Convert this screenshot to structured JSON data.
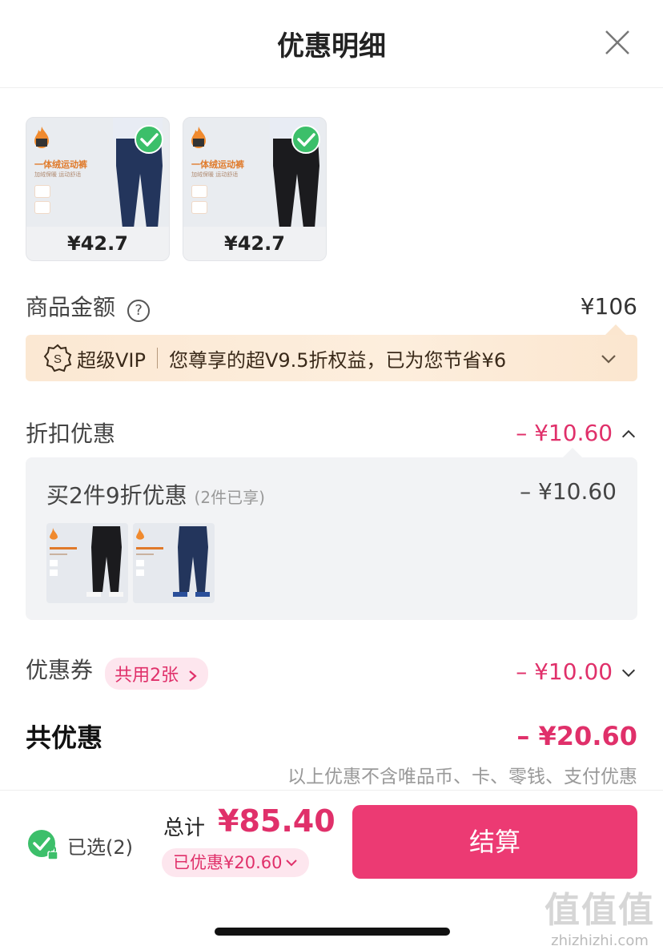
{
  "header": {
    "title": "优惠明细"
  },
  "products": [
    {
      "tag": "一体绒运动裤",
      "sub": "加绒保暖 运动舒适",
      "price": "¥42.7",
      "color": "#23355c"
    },
    {
      "tag": "一体绒运动裤",
      "sub": "加绒保暖 运动舒适",
      "price": "¥42.7",
      "color": "#1b1b1e"
    }
  ],
  "goods_amount": {
    "label": "商品金额",
    "value": "¥106"
  },
  "vip": {
    "label": "超级VIP",
    "text": "您尊享的超V9.5折权益，已为您节省¥6"
  },
  "discount": {
    "label": "折扣优惠",
    "value": "– ¥10.60"
  },
  "discount_detail": {
    "title": "买2件9折优惠",
    "note": "(2件已享)",
    "value": "– ¥10.60"
  },
  "coupon": {
    "label": "优惠券",
    "pill": "共用2张",
    "value": "– ¥10.00"
  },
  "total_discount": {
    "label": "共优惠",
    "value": "– ¥20.60",
    "note": "以上优惠不含唯品币、卡、零钱、支付优惠"
  },
  "footer": {
    "selected": "已选(2)",
    "sum_label": "总计",
    "sum_value": "¥85.40",
    "saved": "已优惠¥20.60",
    "checkout": "结算"
  },
  "watermark": {
    "mark": "值值值",
    "url": "zhizhizhi.com"
  },
  "colors": {
    "accent": "#e0306a",
    "checkout": "#ec3a73",
    "check_green": "#3cbf6a",
    "vip_bg": "#fbe8d3"
  }
}
